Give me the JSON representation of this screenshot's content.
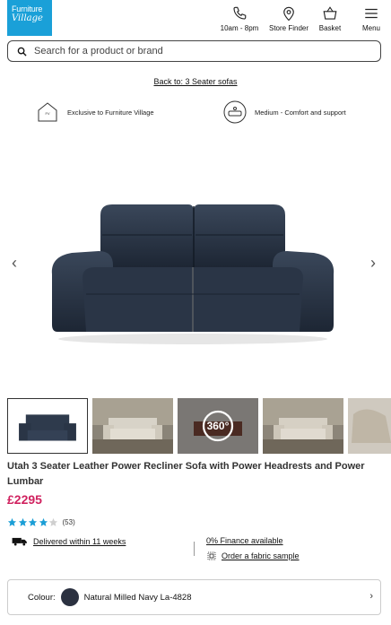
{
  "brand": {
    "line1": "Furniture",
    "line2": "Village",
    "color": "#1aa0d8"
  },
  "header": {
    "phone_label": "10am - 8pm",
    "store_label": "Store Finder",
    "basket_label": "Basket",
    "menu_label": "Menu"
  },
  "search": {
    "placeholder": "Search for a product or brand"
  },
  "breadcrumb": {
    "back_label": "Back to: 3 Seater sofas"
  },
  "features": [
    {
      "icon": "house-icon",
      "label": "Exclusive to Furniture Village"
    },
    {
      "icon": "comfort-cushion-icon",
      "label": "Medium - Comfort and support"
    }
  ],
  "gallery": {
    "prev_icon": "chevron-left-icon",
    "next_icon": "chevron-right-icon",
    "thumb_360_label": "360°"
  },
  "product": {
    "title": "Utah 3 Seater Leather Power Recliner Sofa with Power Headrests and Power Lumbar",
    "price": "£2295",
    "rating_stars": 4,
    "review_count": "(53)",
    "price_color": "#d0225f",
    "star_color": "#1a9ed6"
  },
  "delivery": {
    "label": "Delivered within 11 weeks"
  },
  "finance": {
    "label": "0% Finance available"
  },
  "sample": {
    "label": "Order a fabric sample"
  },
  "colour": {
    "label": "Colour:",
    "value": "Natural Milled Navy La-4828",
    "swatch_color": "#2b3140"
  }
}
